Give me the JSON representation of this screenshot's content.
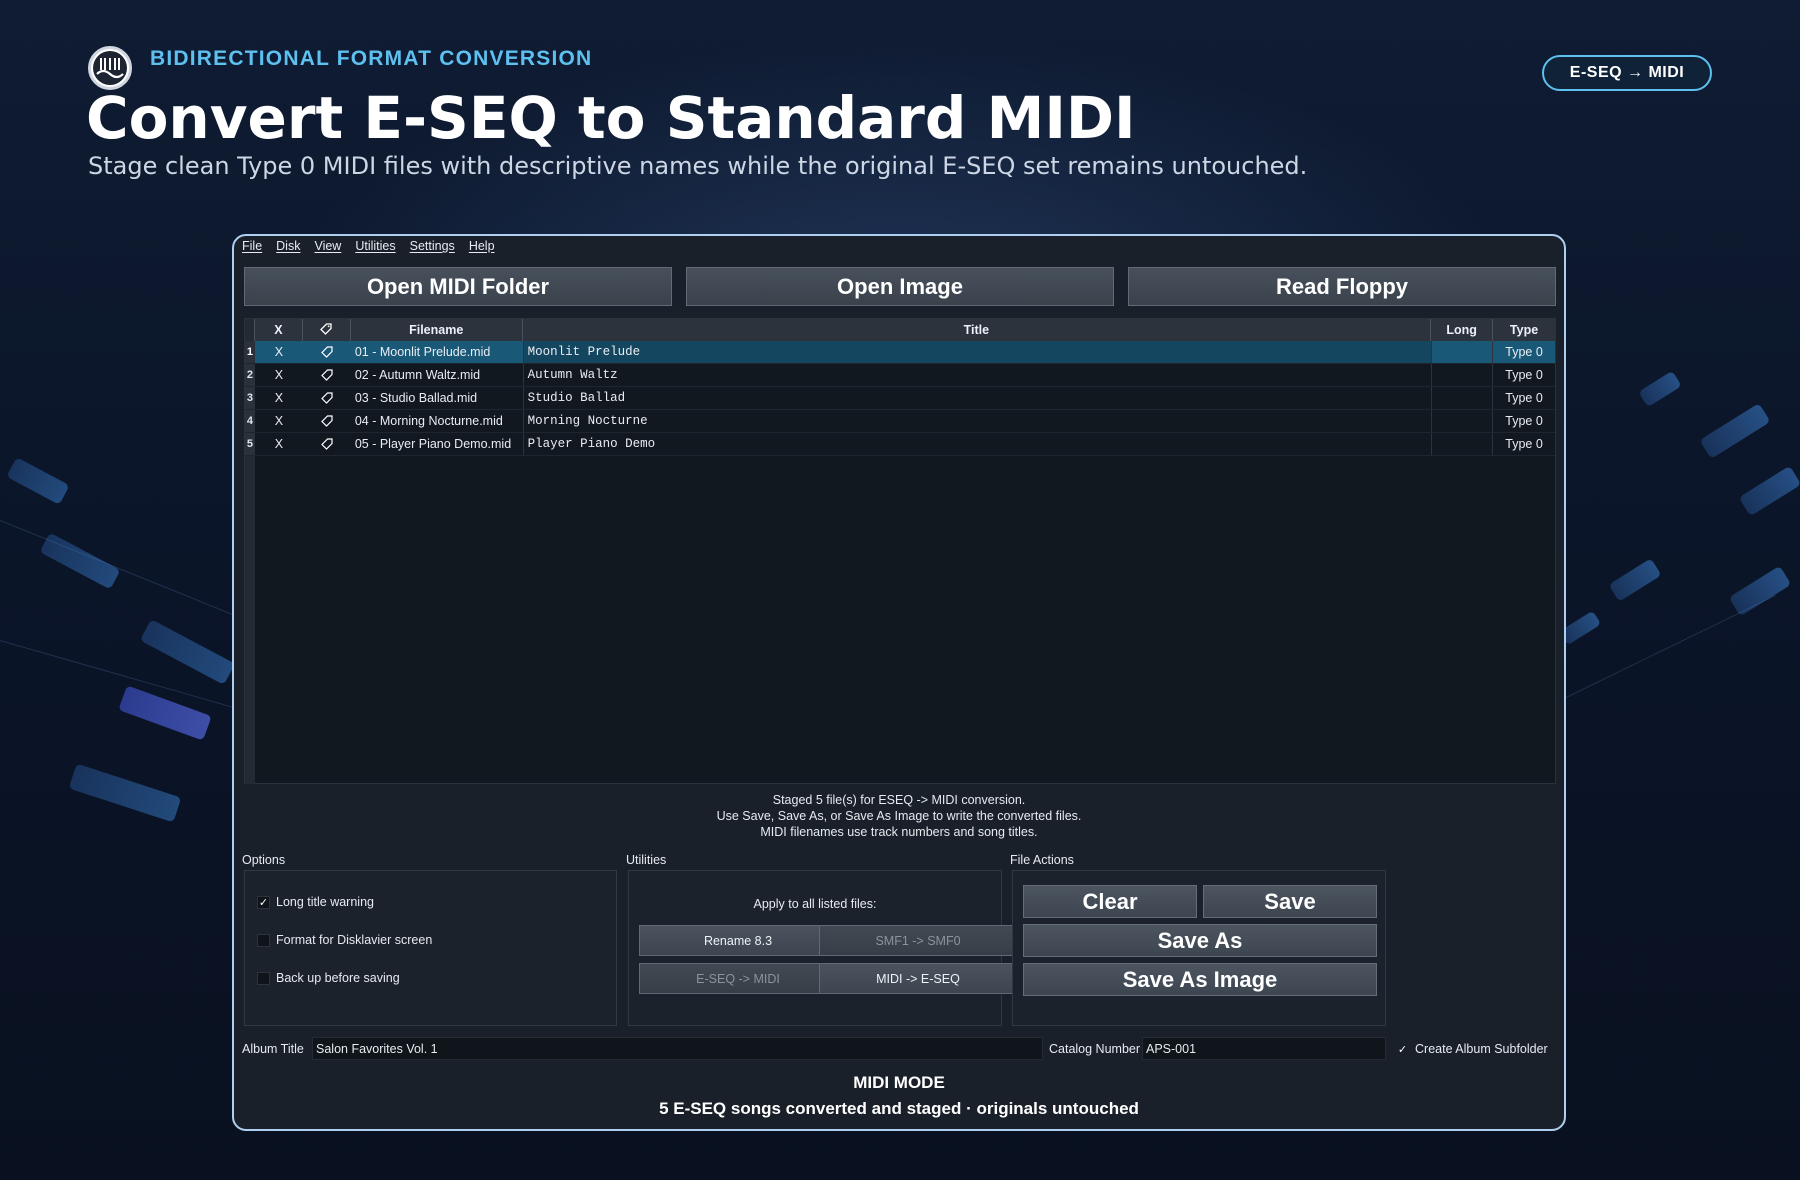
{
  "hero": {
    "kicker": "BIDIRECTIONAL FORMAT CONVERSION",
    "title": "Convert E-SEQ to Standard MIDI",
    "subtitle": "Stage clean Type 0 MIDI files with descriptive names while the original E-SEQ set remains untouched.",
    "mode_pill": "E-SEQ → MIDI",
    "logo_icon": "piano-logo-icon"
  },
  "menu": [
    "File",
    "Disk",
    "View",
    "Utilities",
    "Settings",
    "Help"
  ],
  "top_buttons": {
    "open_midi_folder": "Open MIDI Folder",
    "open_image": "Open Image",
    "read_floppy": "Read Floppy"
  },
  "table": {
    "headers": {
      "x": "X",
      "tag": "tag-icon",
      "filename": "Filename",
      "title": "Title",
      "long": "Long",
      "type": "Type"
    },
    "rows": [
      {
        "num": "1",
        "x": "X",
        "filename": "01 - Moonlit Prelude.mid",
        "title": "Moonlit Prelude",
        "long": "",
        "type": "Type 0"
      },
      {
        "num": "2",
        "x": "X",
        "filename": "02 - Autumn Waltz.mid",
        "title": "Autumn Waltz",
        "long": "",
        "type": "Type 0"
      },
      {
        "num": "3",
        "x": "X",
        "filename": "03 - Studio Ballad.mid",
        "title": "Studio Ballad",
        "long": "",
        "type": "Type 0"
      },
      {
        "num": "4",
        "x": "X",
        "filename": "04 - Morning Nocturne.mid",
        "title": "Morning Nocturne",
        "long": "",
        "type": "Type 0"
      },
      {
        "num": "5",
        "x": "X",
        "filename": "05 - Player Piano Demo.mid",
        "title": "Player Piano Demo",
        "long": "",
        "type": "Type 0"
      }
    ]
  },
  "status": {
    "line1": "Staged 5 file(s) for ESEQ -> MIDI conversion.",
    "line2": "Use Save, Save As, or Save As Image to write the converted files.",
    "line3": "MIDI filenames use track numbers and song titles."
  },
  "options": {
    "label": "Options",
    "long_title_warning": {
      "label": "Long title warning",
      "checked": true
    },
    "format_disklavier": {
      "label": "Format for Disklavier screen",
      "checked": false
    },
    "backup": {
      "label": "Back up before saving",
      "checked": false
    }
  },
  "utilities": {
    "label": "Utilities",
    "apply_text": "Apply to all listed files:",
    "rename": "Rename 8.3",
    "smf1_smf0": "SMF1 -> SMF0",
    "eseq_midi": "E-SEQ -> MIDI",
    "midi_eseq": "MIDI -> E-SEQ"
  },
  "file_actions": {
    "label": "File Actions",
    "clear": "Clear",
    "save": "Save",
    "save_as": "Save As",
    "save_as_image": "Save As Image"
  },
  "fields": {
    "album_title_label": "Album Title",
    "album_title_value": "Salon Favorites Vol. 1",
    "catalog_label": "Catalog Number",
    "catalog_value": "APS-001",
    "create_subfolder_label": "Create Album Subfolder",
    "create_subfolder_checked": true
  },
  "footer": {
    "mode": "MIDI MODE",
    "summary": "5 E-SEQ songs converted and staged · originals untouched"
  },
  "colors": {
    "accent": "#5ec0ef",
    "selected_row": "#1a5878",
    "window_border": "#aecff0"
  }
}
